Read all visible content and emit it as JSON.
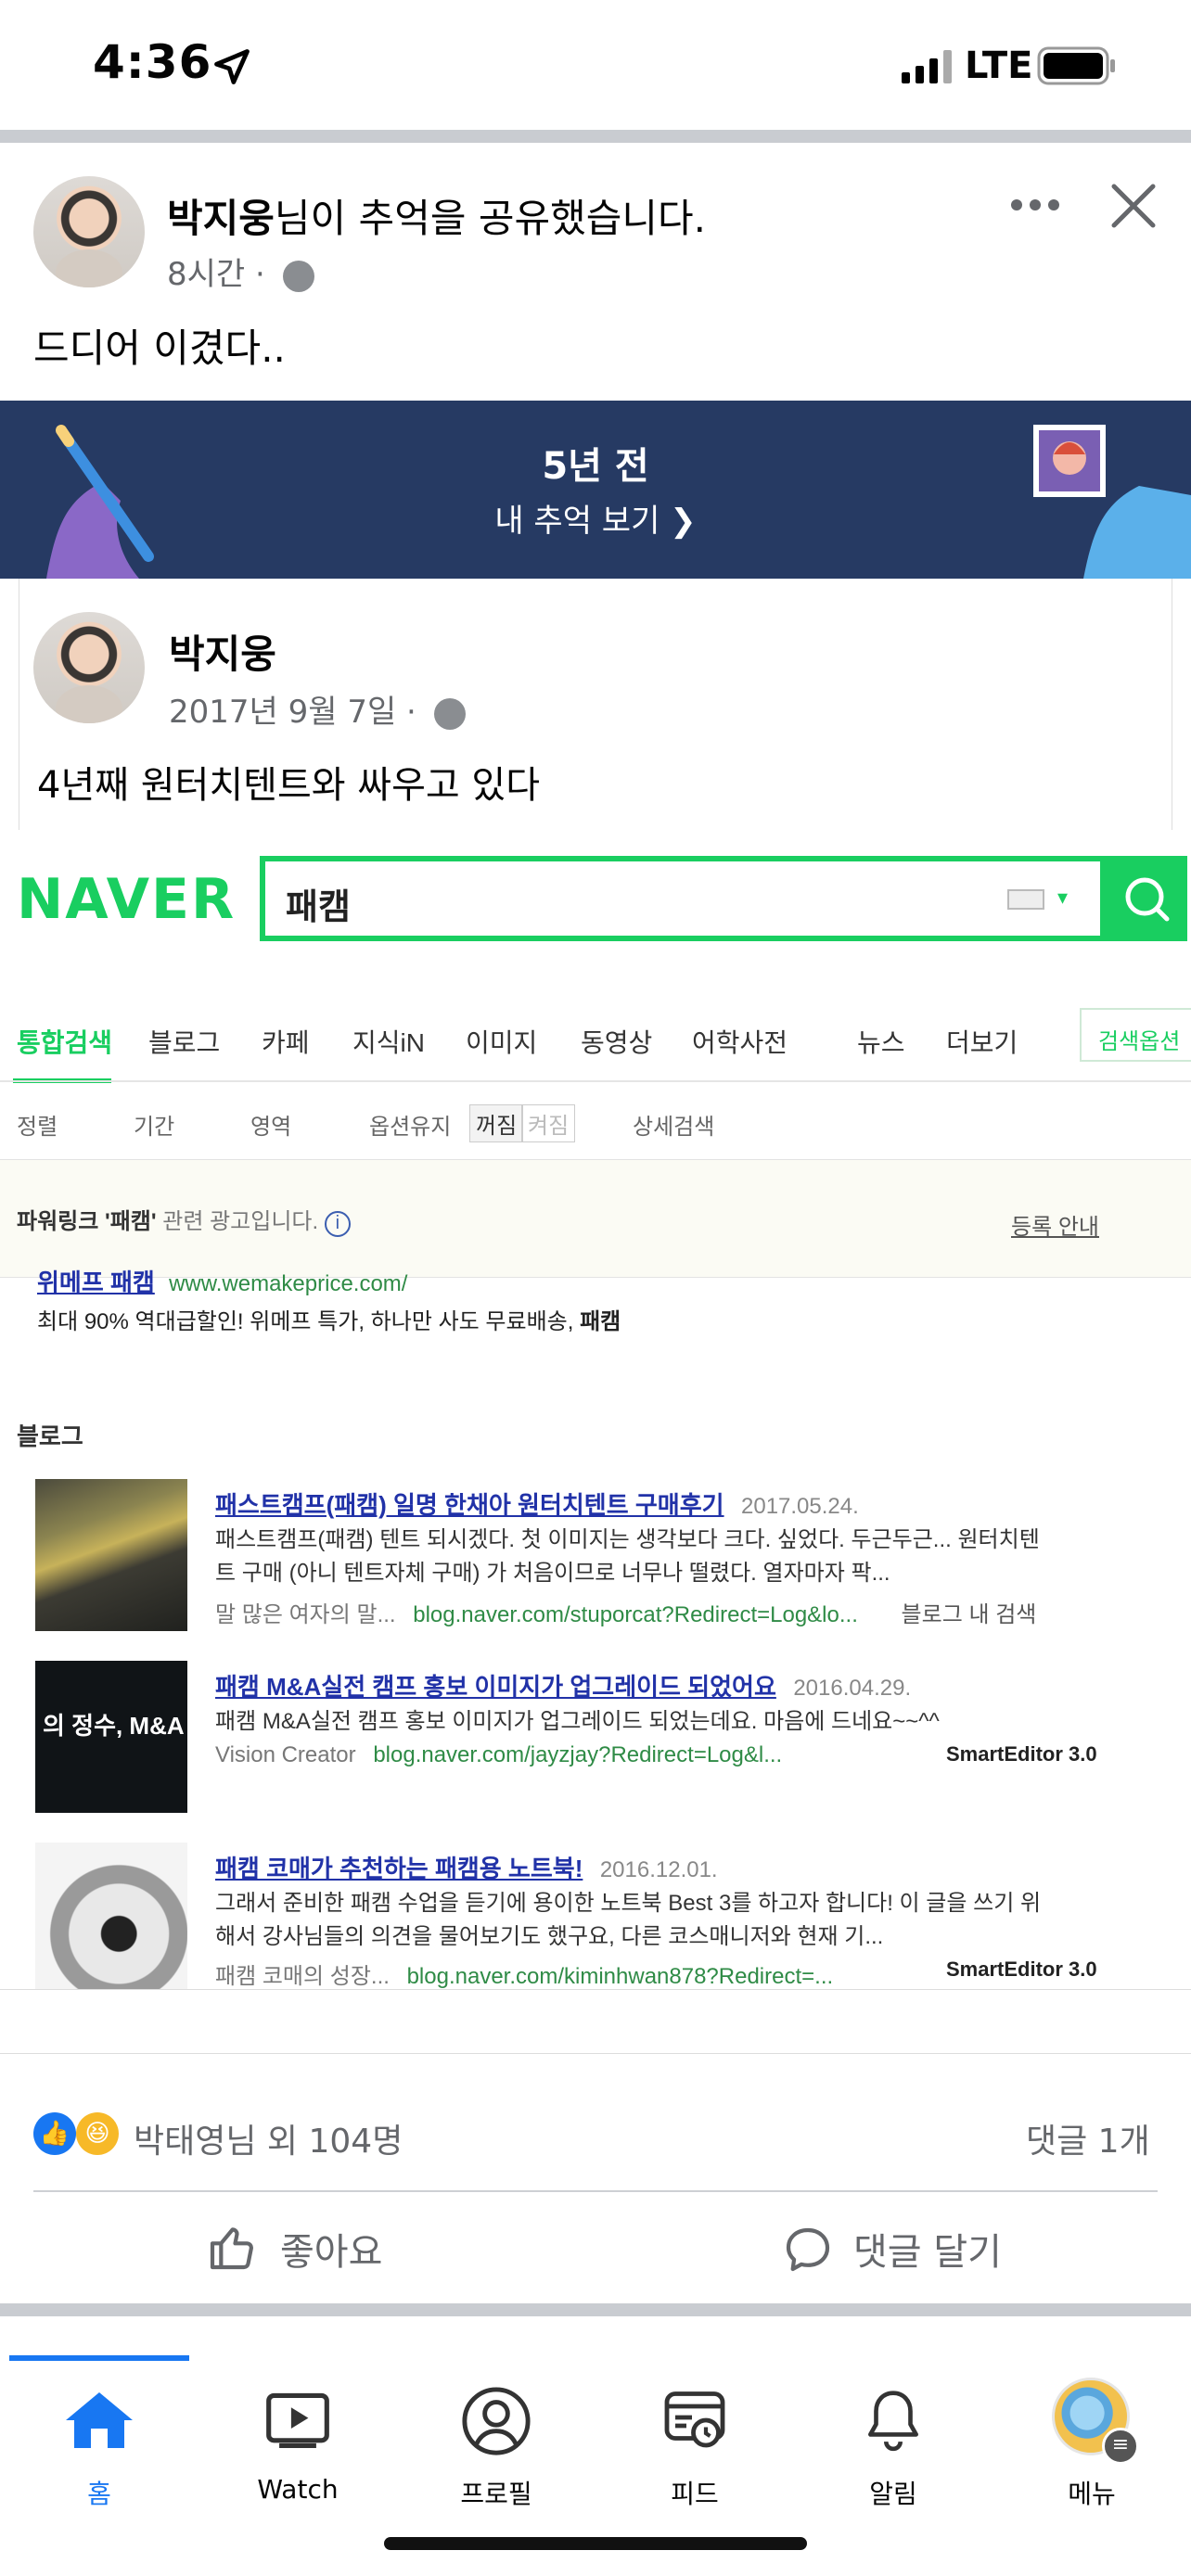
{
  "status_bar": {
    "time": "4:36",
    "network": "LTE"
  },
  "post": {
    "author": "박지웅",
    "action_text": "님이 추억을 공유했습니다.",
    "time": "8시간",
    "caption": "드디어 이겼다.."
  },
  "memory_banner": {
    "years_ago": "5년 전",
    "link_label": "내 추억 보기"
  },
  "original_post": {
    "author": "박지웅",
    "date": "2017년 9월 7일",
    "text": "4년째 원터치텐트와 싸우고 있다"
  },
  "naver": {
    "logo": "NAVER",
    "query": "패캠",
    "tabs": [
      "통합검색",
      "블로그",
      "카페",
      "지식iN",
      "이미지",
      "동영상",
      "어학사전",
      "뉴스",
      "더보기"
    ],
    "search_options_label": "검색옵션",
    "filters": [
      "정렬",
      "기간",
      "영역",
      "옵션유지",
      "꺼짐",
      "켜짐",
      "상세검색"
    ],
    "powerlink": {
      "label_prefix": "파워링크",
      "label_keyword": "'패캠'",
      "label_suffix": "관련 광고입니다.",
      "register": "등록 안내",
      "title": "위메프 패캠",
      "url": "www.wemakeprice.com/",
      "desc": "최대 90% 역대급할인! 위메프 특가, 하나만 사도 무료배송,",
      "desc_bold": "패캠"
    },
    "blog_section_title": "블로그",
    "blog_results": [
      {
        "title": "패스트캠프(패캠) 일명 한채아 원터치텐트 구매후기",
        "date": "2017.05.24.",
        "text1": "패스트캠프(패캠) 텐트 되시겠다. 첫 이미지는 생각보다 크다. 싶었다. 두근두근... 원터치텐",
        "text2": "트 구매 (아니 텐트자체 구매) 가 처음이므로 너무나 떨렸다. 열자마자 팍...",
        "source": "말 많은 여자의 말...",
        "url": "blog.naver.com/stuporcat?Redirect=Log&lo...",
        "extra": "블로그 내 검색"
      },
      {
        "title": "패캠 M&A실전 캠프 홍보 이미지가 업그레이드 되었어요",
        "date": "2016.04.29.",
        "text1": "패캠 M&A실전 캠프 홍보 이미지가 업그레이드 되었는데요. 마음에 드네요~~^^",
        "text2": "",
        "source": "Vision Creator",
        "url": "blog.naver.com/jayzjay?Redirect=Log&l...",
        "extra": "SmartEditor 3.0",
        "thumb_text": "의 정수, M&A"
      },
      {
        "title": "패캠 코매가 추천하는 패캠용 노트북!",
        "date": "2016.12.01.",
        "text1": "그래서 준비한 패캠 수업을 듣기에 용이한 노트북 Best 3를 하고자 합니다! 이 글을 쓰기 위",
        "text2": "해서 강사님들의 의견을 물어보기도 했구요, 다른 코스매니저와 현재 기...",
        "source": "패캠 코매의 성장...",
        "url": "blog.naver.com/kiminhwan878?Redirect=...",
        "extra": "SmartEditor 3.0"
      }
    ]
  },
  "reactions": {
    "summary": "박태영님 외 104명",
    "comments": "댓글 1개"
  },
  "actions": {
    "like": "좋아요",
    "comment": "댓글 달기"
  },
  "tabbar": [
    {
      "label": "홈",
      "icon": "home-icon"
    },
    {
      "label": "Watch",
      "icon": "watch-icon"
    },
    {
      "label": "프로필",
      "icon": "profile-icon"
    },
    {
      "label": "피드",
      "icon": "feed-icon"
    },
    {
      "label": "알림",
      "icon": "bell-icon"
    },
    {
      "label": "메뉴",
      "icon": "menu-avatar-icon"
    }
  ],
  "colors": {
    "facebook_blue": "#1877f2",
    "naver_green": "#19ce60",
    "banner_navy": "#263a63"
  }
}
